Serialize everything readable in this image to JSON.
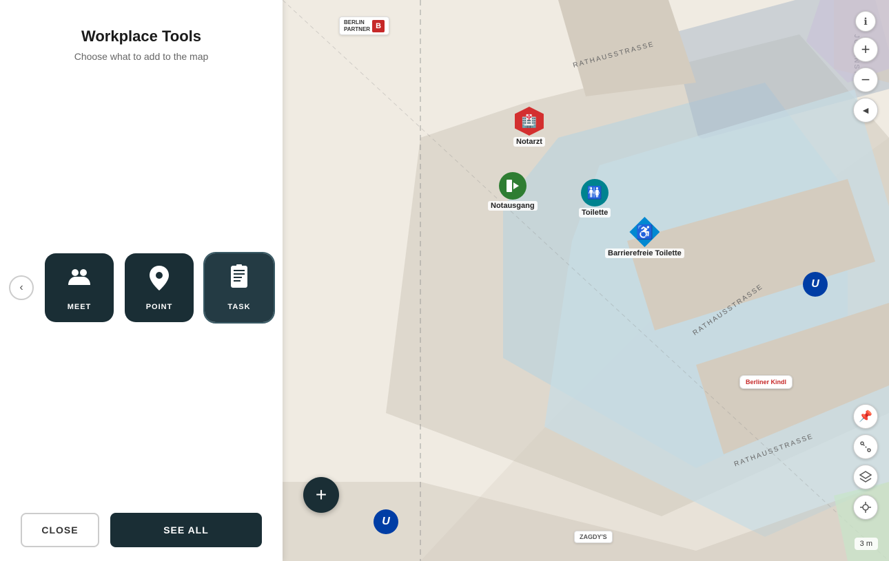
{
  "panel": {
    "title": "Workplace Tools",
    "subtitle": "Choose what to add to the map",
    "tools": [
      {
        "id": "meet",
        "label": "MEET",
        "icon": "👥"
      },
      {
        "id": "point",
        "label": "POINT",
        "icon": "📍"
      },
      {
        "id": "task",
        "label": "TASK",
        "icon": "📋"
      }
    ],
    "nav_arrow": "‹",
    "close_button": "CLOSE",
    "see_all_button": "SEE ALL"
  },
  "map": {
    "markers": [
      {
        "id": "notarzt",
        "label": "Notarzt",
        "type": "red-hex",
        "icon": "🏥"
      },
      {
        "id": "notausgang",
        "label": "Notausgang",
        "type": "green",
        "icon": "🚪"
      },
      {
        "id": "toilette",
        "label": "Toilette",
        "type": "teal",
        "icon": "🚻"
      },
      {
        "id": "barrierefreie",
        "label": "Barrierefreie Toilette",
        "type": "blue-diamond",
        "icon": "♿"
      }
    ],
    "streets": [
      "RATHAUSSTRASSE",
      "JUDENSTR.",
      "RATHAUSSTRASSE"
    ],
    "add_button": "+",
    "scale": "3 m",
    "berlin_partner": "BERLIN PARTNER",
    "berlin_b": "B",
    "ubahn": "U"
  },
  "controls": {
    "zoom_in": "+",
    "zoom_out": "−",
    "compass": "◄",
    "info": "ℹ",
    "layers": "⊕",
    "measure": "⊙",
    "locate": "⊛",
    "pin": "📌"
  }
}
